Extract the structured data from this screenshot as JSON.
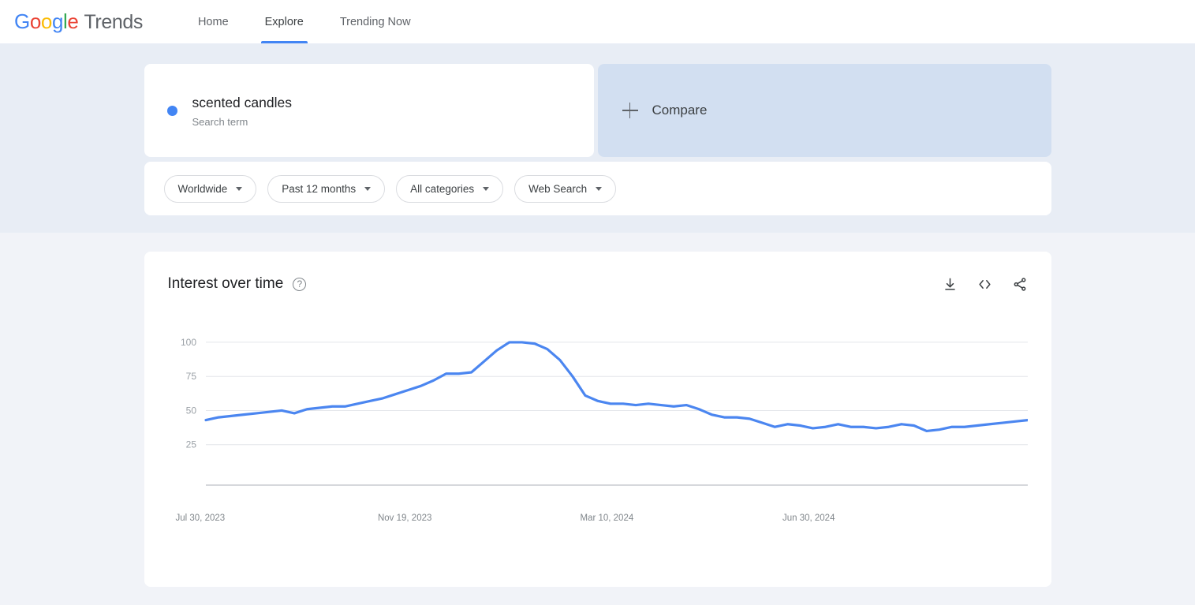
{
  "nav": {
    "logo": {
      "google": "Google",
      "product": "Trends"
    },
    "links": [
      {
        "label": "Home",
        "active": false
      },
      {
        "label": "Explore",
        "active": true
      },
      {
        "label": "Trending Now",
        "active": false
      }
    ]
  },
  "query": {
    "term": {
      "title": "scented candles",
      "subtitle": "Search term",
      "dot_color": "#4285F4"
    },
    "compare": {
      "label": "Compare",
      "icon": "plus-icon"
    }
  },
  "filters": [
    {
      "name": "location",
      "label": "Worldwide"
    },
    {
      "name": "time-range",
      "label": "Past 12 months"
    },
    {
      "name": "category",
      "label": "All categories"
    },
    {
      "name": "search-type",
      "label": "Web Search"
    }
  ],
  "chart_card": {
    "title": "Interest over time",
    "help_icon": "help-circle-icon",
    "actions": [
      {
        "name": "download-csv-button",
        "icon": "download-icon"
      },
      {
        "name": "embed-code-button",
        "icon": "code-embed-icon"
      },
      {
        "name": "share-button",
        "icon": "share-icon"
      }
    ]
  },
  "chart_data": {
    "type": "line",
    "title": "Interest over time",
    "xlabel": "",
    "ylabel": "",
    "ylim": [
      0,
      104
    ],
    "grid": true,
    "grid_values": [
      100,
      75,
      50,
      25
    ],
    "ytick_labels": [
      "100",
      "75",
      "50",
      "25"
    ],
    "legend": [
      "scented candles"
    ],
    "series_color": "#4B86F0",
    "xtick_labels": [
      "Jul 30, 2023",
      "Nov 19, 2023",
      "Mar 10, 2024",
      "Jun 30, 2024"
    ],
    "xtick_indices": [
      0,
      16,
      32,
      48
    ],
    "x": [
      "Jul 30, 2023",
      "Aug 6, 2023",
      "Aug 13, 2023",
      "Aug 20, 2023",
      "Aug 27, 2023",
      "Sep 3, 2023",
      "Sep 10, 2023",
      "Sep 17, 2023",
      "Sep 24, 2023",
      "Oct 1, 2023",
      "Oct 8, 2023",
      "Oct 15, 2023",
      "Oct 22, 2023",
      "Oct 29, 2023",
      "Nov 5, 2023",
      "Nov 12, 2023",
      "Nov 19, 2023",
      "Nov 26, 2023",
      "Dec 3, 2023",
      "Dec 10, 2023",
      "Dec 17, 2023",
      "Dec 24, 2023",
      "Dec 31, 2023",
      "Jan 7, 2024",
      "Jan 14, 2024",
      "Jan 21, 2024",
      "Jan 28, 2024",
      "Feb 4, 2024",
      "Feb 11, 2024",
      "Feb 18, 2024",
      "Feb 25, 2024",
      "Mar 3, 2024",
      "Mar 10, 2024",
      "Mar 17, 2024",
      "Mar 24, 2024",
      "Mar 31, 2024",
      "Apr 7, 2024",
      "Apr 14, 2024",
      "Apr 21, 2024",
      "Apr 28, 2024",
      "May 5, 2024",
      "May 12, 2024",
      "May 19, 2024",
      "May 26, 2024",
      "Jun 2, 2024",
      "Jun 9, 2024",
      "Jun 16, 2024",
      "Jun 23, 2024",
      "Jun 30, 2024",
      "Jul 7, 2024",
      "Jul 14, 2024",
      "Jul 21, 2024"
    ],
    "values": [
      43,
      45,
      46,
      47,
      48,
      49,
      50,
      48,
      51,
      52,
      53,
      53,
      55,
      57,
      59,
      62,
      65,
      68,
      72,
      77,
      77,
      78,
      86,
      94,
      100,
      100,
      99,
      95,
      87,
      75,
      61,
      57,
      55,
      55,
      54,
      55,
      54,
      53,
      54,
      51,
      47,
      45,
      45,
      44,
      41,
      38,
      40,
      39,
      37,
      38,
      40,
      38,
      38,
      37,
      38,
      40,
      39,
      35,
      36,
      38,
      38,
      39,
      40,
      41,
      42,
      43
    ],
    "peak_value": 100,
    "min_value": 35
  }
}
